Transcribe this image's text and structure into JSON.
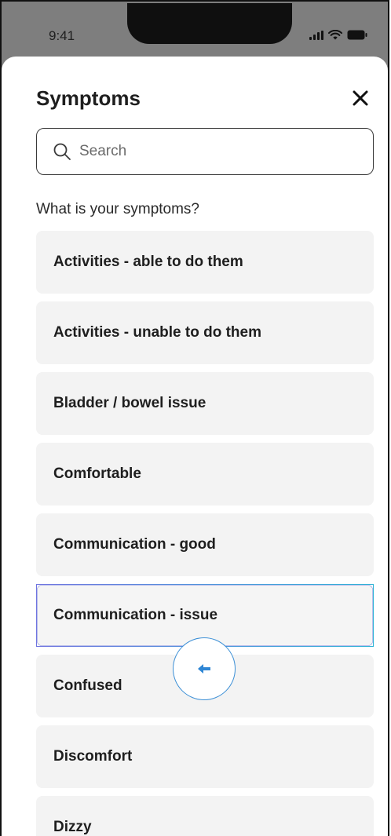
{
  "status_bar": {
    "time": "9:41"
  },
  "sheet": {
    "title": "Symptoms",
    "search": {
      "placeholder": "Search",
      "value": ""
    },
    "question": "What is your symptoms?",
    "items": [
      {
        "label": "Activities - able to do them",
        "selected": false
      },
      {
        "label": "Activities - unable to do them",
        "selected": false
      },
      {
        "label": "Bladder / bowel issue",
        "selected": false
      },
      {
        "label": "Comfortable",
        "selected": false
      },
      {
        "label": "Communication - good",
        "selected": false
      },
      {
        "label": "Communication - issue",
        "selected": true
      },
      {
        "label": "Confused",
        "selected": false
      },
      {
        "label": "Discomfort",
        "selected": false
      },
      {
        "label": "Dizzy",
        "selected": false
      }
    ]
  },
  "icons": {
    "close": "close-icon",
    "search": "search-icon",
    "fab": "arrow-left-icon"
  },
  "colors": {
    "accent": "#3b8fd6",
    "selected_border_start": "#6f74e0",
    "selected_border_end": "#2fb3d6",
    "item_background": "#f3f3f3",
    "backdrop": "#7e7e7e"
  }
}
